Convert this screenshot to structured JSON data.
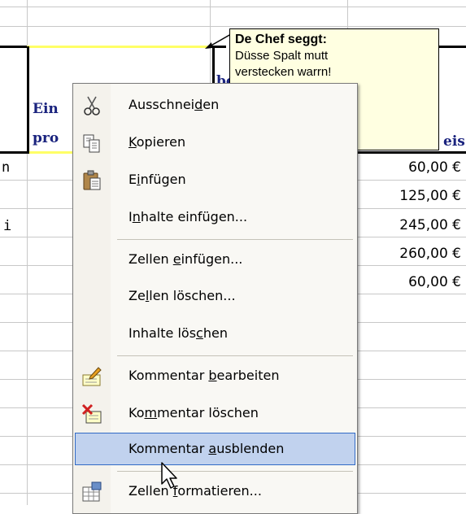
{
  "comment": {
    "author": "De Chef seggt:",
    "text_line1": "Düsse Spalt mutt",
    "text_line2": "verstecken warrn!"
  },
  "sheet": {
    "header_fragments": {
      "col_b_line1": "Ein",
      "col_b_line2": "pro",
      "col_c_fragment": "be",
      "col_d_fragment": "eis"
    },
    "row_stubs": [
      "n",
      "i"
    ],
    "prices": [
      "60,00 €",
      "125,00 €",
      "245,00 €",
      "260,00 €",
      "60,00 €"
    ]
  },
  "context_menu": {
    "items": [
      {
        "label_pre": "Ausschnei",
        "mnemonic": "d",
        "label_post": "en",
        "icon": "scissors-icon"
      },
      {
        "label_pre": "",
        "mnemonic": "K",
        "label_post": "opieren",
        "icon": "copy-icon"
      },
      {
        "label_pre": "E",
        "mnemonic": "i",
        "label_post": "nfügen",
        "icon": "paste-icon"
      },
      {
        "label_pre": "I",
        "mnemonic": "n",
        "label_post": "halte einfügen...",
        "icon": ""
      },
      {
        "label_pre": "Zellen ",
        "mnemonic": "e",
        "label_post": "infügen...",
        "icon": ""
      },
      {
        "label_pre": "Ze",
        "mnemonic": "l",
        "label_post": "len löschen...",
        "icon": ""
      },
      {
        "label_pre": "Inhalte lös",
        "mnemonic": "c",
        "label_post": "hen",
        "icon": ""
      },
      {
        "label_pre": "Kommentar ",
        "mnemonic": "b",
        "label_post": "earbeiten",
        "icon": "edit-comment-icon"
      },
      {
        "label_pre": "Ko",
        "mnemonic": "m",
        "label_post": "mentar löschen",
        "icon": "delete-comment-icon"
      },
      {
        "label_pre": "Kommentar ",
        "mnemonic": "a",
        "label_post": "usblenden",
        "icon": ""
      },
      {
        "label_pre": "Zellen ",
        "mnemonic": "f",
        "label_post": "ormatieren...",
        "icon": "format-cells-icon"
      }
    ],
    "highlighted_index": 9
  },
  "colors": {
    "menu_highlight": "#c1d2ee",
    "menu_highlight_border": "#316ac5",
    "comment_bg": "#ffffe1",
    "header_text": "#1a237e"
  }
}
